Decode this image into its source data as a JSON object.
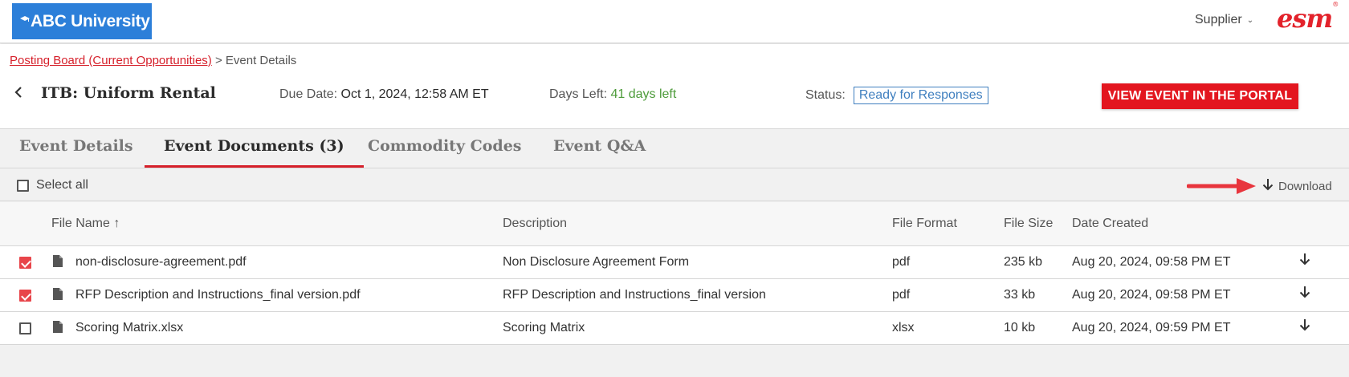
{
  "brand": {
    "logo_text": "ABC University",
    "supplier_menu": "Supplier",
    "esm_logo": "esm",
    "registered_mark": "®"
  },
  "breadcrumb": {
    "link": "Posting Board (Current Opportunities)",
    "separator": ">",
    "current": "Event Details"
  },
  "event": {
    "title": "ITB: Uniform Rental",
    "due_label": "Due Date:",
    "due_value": "Oct 1, 2024, 12:58 AM ET",
    "days_label": "Days Left:",
    "days_value": "41 days left",
    "status_label": "Status:",
    "status_value": "Ready for Responses",
    "view_button": "VIEW EVENT IN THE PORTAL"
  },
  "tabs": [
    {
      "label": "Event Details",
      "active": false
    },
    {
      "label": "Event Documents (3)",
      "active": true
    },
    {
      "label": "Commodity Codes",
      "active": false
    },
    {
      "label": "Event Q&A",
      "active": false
    }
  ],
  "toolbar": {
    "select_all": "Select all",
    "download": "Download"
  },
  "table": {
    "columns": [
      "File Name",
      "Description",
      "File Format",
      "File Size",
      "Date Created"
    ],
    "sort_indicator": "↑",
    "rows": [
      {
        "checked": true,
        "file_name": "non-disclosure-agreement.pdf",
        "description": "Non Disclosure Agreement Form",
        "format": "pdf",
        "size": "235 kb",
        "date": "Aug 20, 2024, 09:58 PM ET"
      },
      {
        "checked": true,
        "file_name": "RFP Description and Instructions_final version.pdf",
        "description": "RFP Description and Instructions_final version",
        "format": "pdf",
        "size": "33 kb",
        "date": "Aug 20, 2024, 09:58 PM ET"
      },
      {
        "checked": false,
        "file_name": "Scoring Matrix.xlsx",
        "description": "Scoring Matrix",
        "format": "xlsx",
        "size": "10 kb",
        "date": "Aug 20, 2024, 09:59 PM ET"
      }
    ]
  },
  "colors": {
    "accent_red": "#e3161f",
    "logo_blue": "#2c7fd9",
    "days_green": "#4d9b3a",
    "status_blue": "#3f7fbf"
  }
}
